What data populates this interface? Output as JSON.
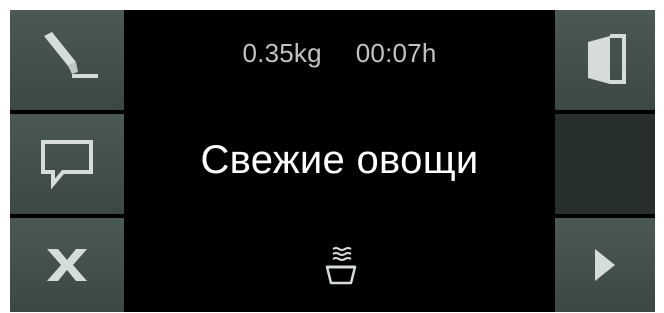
{
  "status": {
    "weight": "0.35kg",
    "duration": "00:07h"
  },
  "program": {
    "name": "Свежие овощи"
  },
  "left_buttons": [
    {
      "icon": "pen-edit-icon"
    },
    {
      "icon": "speech-bubble-icon"
    },
    {
      "icon": "close-x-icon"
    }
  ],
  "right_buttons": [
    {
      "icon": "door-icon"
    },
    {
      "icon": "empty"
    },
    {
      "icon": "play-triangle-icon"
    }
  ],
  "program_icon": "steam-bowl-icon",
  "colors": {
    "screen": "#000000",
    "tile": "#43504e",
    "tile_blank": "#27302f",
    "icon": "#d6dcdb",
    "text_primary": "#ffffff",
    "text_secondary": "#bfc4c3"
  }
}
